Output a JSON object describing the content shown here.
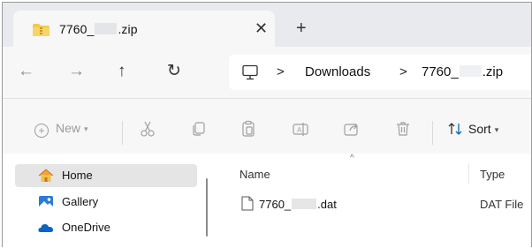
{
  "tab": {
    "title_prefix": "7760_",
    "title_suffix": ".zip",
    "close_glyph": "✕",
    "new_tab_glyph": "+",
    "icon": "zip-folder-icon"
  },
  "nav": {
    "back_glyph": "←",
    "forward_glyph": "→",
    "up_glyph": "↑",
    "refresh_glyph": "↻",
    "chevron": ">",
    "breadcrumb": [
      {
        "label": "Downloads"
      },
      {
        "label_prefix": "7760_",
        "label_suffix": ".zip"
      }
    ]
  },
  "command_bar": {
    "new_label": "New",
    "sort_label": "Sort",
    "icons": [
      "cut-icon",
      "copy-icon",
      "paste-icon",
      "rename-icon",
      "share-icon",
      "delete-icon",
      "sort-icon"
    ]
  },
  "sidebar": {
    "items": [
      {
        "label": "Home",
        "icon": "home-icon",
        "selected": true
      },
      {
        "label": "Gallery",
        "icon": "gallery-icon",
        "selected": false
      },
      {
        "label": "OneDrive",
        "icon": "onedrive-icon",
        "selected": false
      }
    ]
  },
  "file_list": {
    "columns": [
      "Name",
      "Type"
    ],
    "rows": [
      {
        "name_prefix": "7760_",
        "name_suffix": ".dat",
        "type": "DAT File"
      }
    ]
  },
  "colors": {
    "accent": "#0067c0",
    "folder": "#f2c94c",
    "selected_bg": "#e5e5e5"
  }
}
